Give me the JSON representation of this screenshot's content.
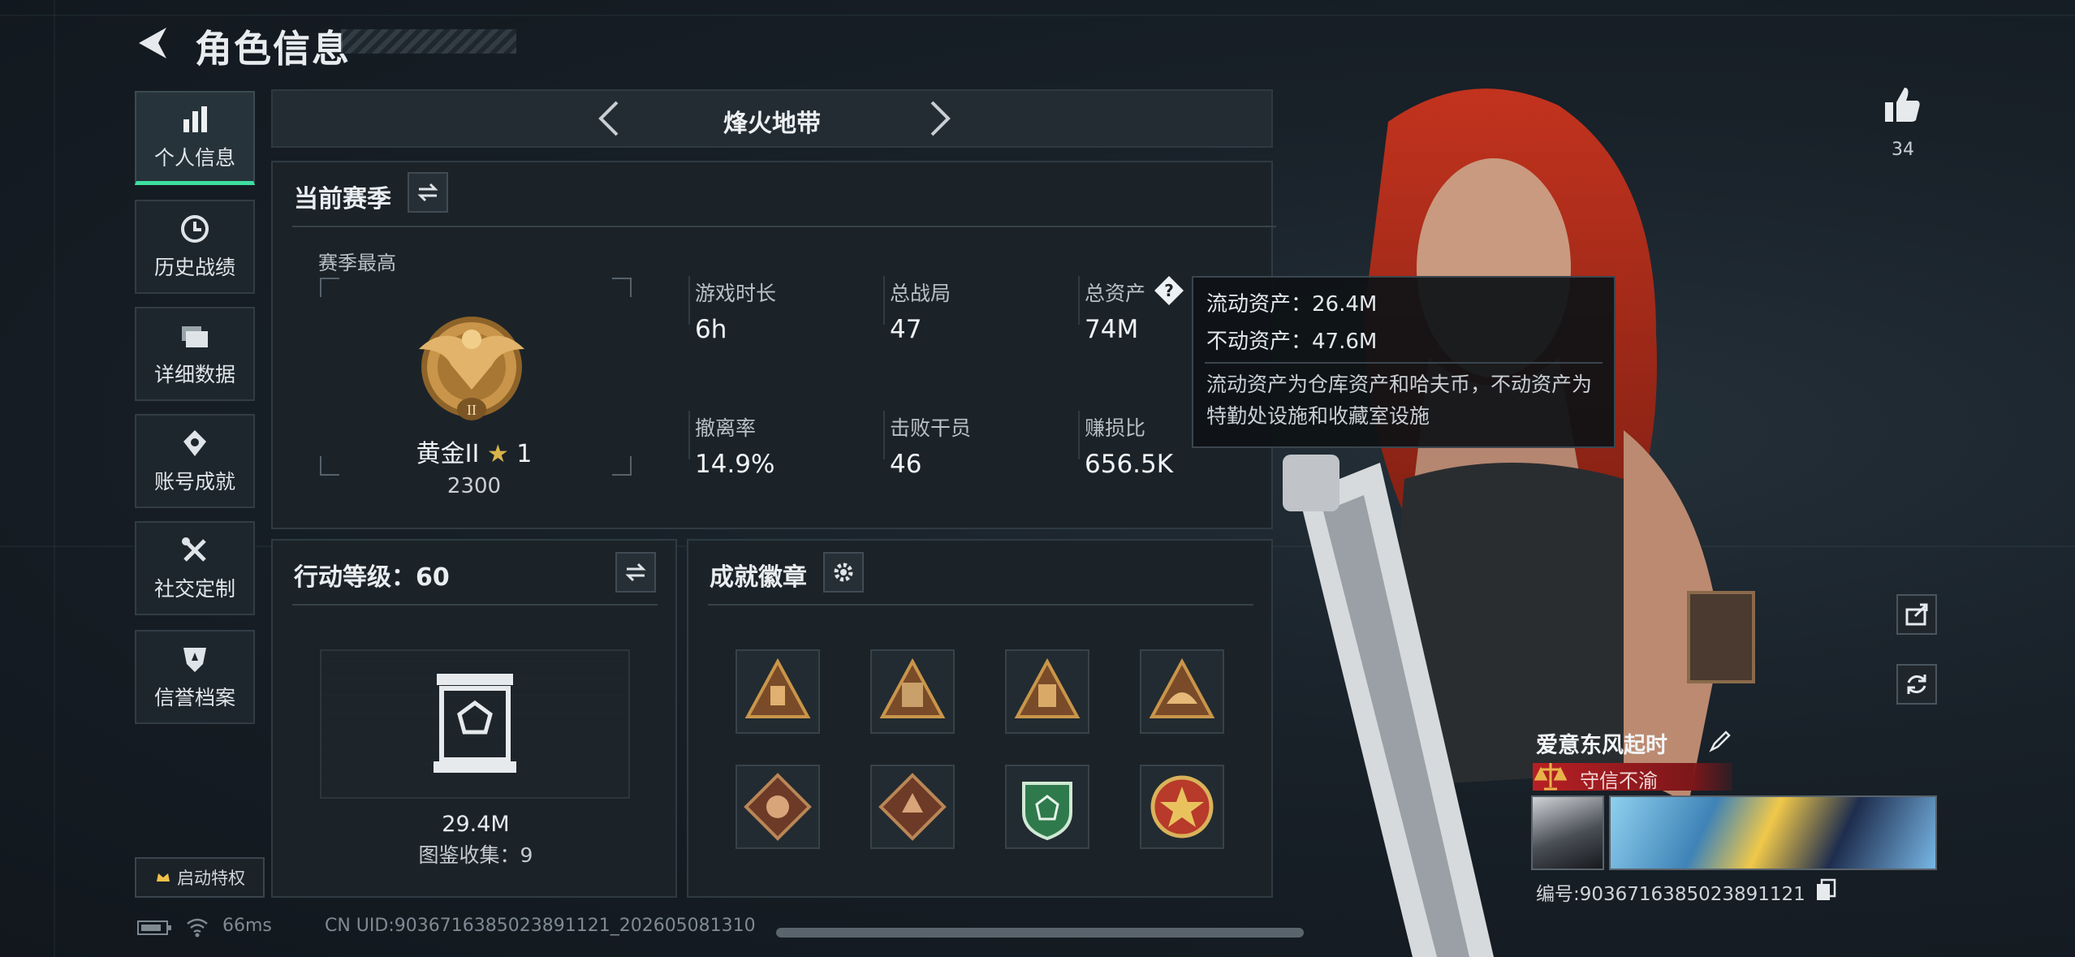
{
  "header": {
    "title": "角色信息"
  },
  "nav": {
    "items": [
      {
        "label": "个人信息",
        "icon": "bar-chart-icon"
      },
      {
        "label": "历史战绩",
        "icon": "clock-icon"
      },
      {
        "label": "详细数据",
        "icon": "folder-icon"
      },
      {
        "label": "账号成就",
        "icon": "medal-icon"
      },
      {
        "label": "社交定制",
        "icon": "tools-icon"
      },
      {
        "label": "信誉档案",
        "icon": "shield-icon"
      }
    ],
    "privilege_label": "启动特权"
  },
  "mode_bar": {
    "title": "烽火地带"
  },
  "season": {
    "title": "当前赛季",
    "best_label": "赛季最高",
    "rank_name": "黄金II",
    "rank_stars": "1",
    "rank_points": "2300",
    "stats": [
      {
        "label": "游戏时长",
        "value": "6h"
      },
      {
        "label": "总战局",
        "value": "47"
      },
      {
        "label": "总资产",
        "value": "74M"
      },
      {
        "label": "撤离率",
        "value": "14.9%"
      },
      {
        "label": "击败干员",
        "value": "46"
      },
      {
        "label": "赚损比",
        "value": "656.5K"
      }
    ]
  },
  "tooltip": {
    "liquid": "流动资产：26.4M",
    "fixed": "不动资产：47.6M",
    "desc": "流动资产为仓库资产和哈夫币，不动资产为特勤处设施和收藏室设施"
  },
  "action_level": {
    "title": "行动等级：60",
    "value": "29.4M",
    "collection": "图鉴收集：9"
  },
  "badges": {
    "title": "成就徽章"
  },
  "right": {
    "like_count": "34",
    "player_name": "爱意东风起时",
    "reputation": "守信不渝",
    "player_id": "编号:9036716385023891121"
  },
  "status": {
    "ping": "66ms",
    "uid": "CN UID:9036716385023891121_202605081310"
  },
  "colors": {
    "accent": "#3de0a0",
    "reputation": "#b81f24",
    "gold": "#c9954a"
  }
}
